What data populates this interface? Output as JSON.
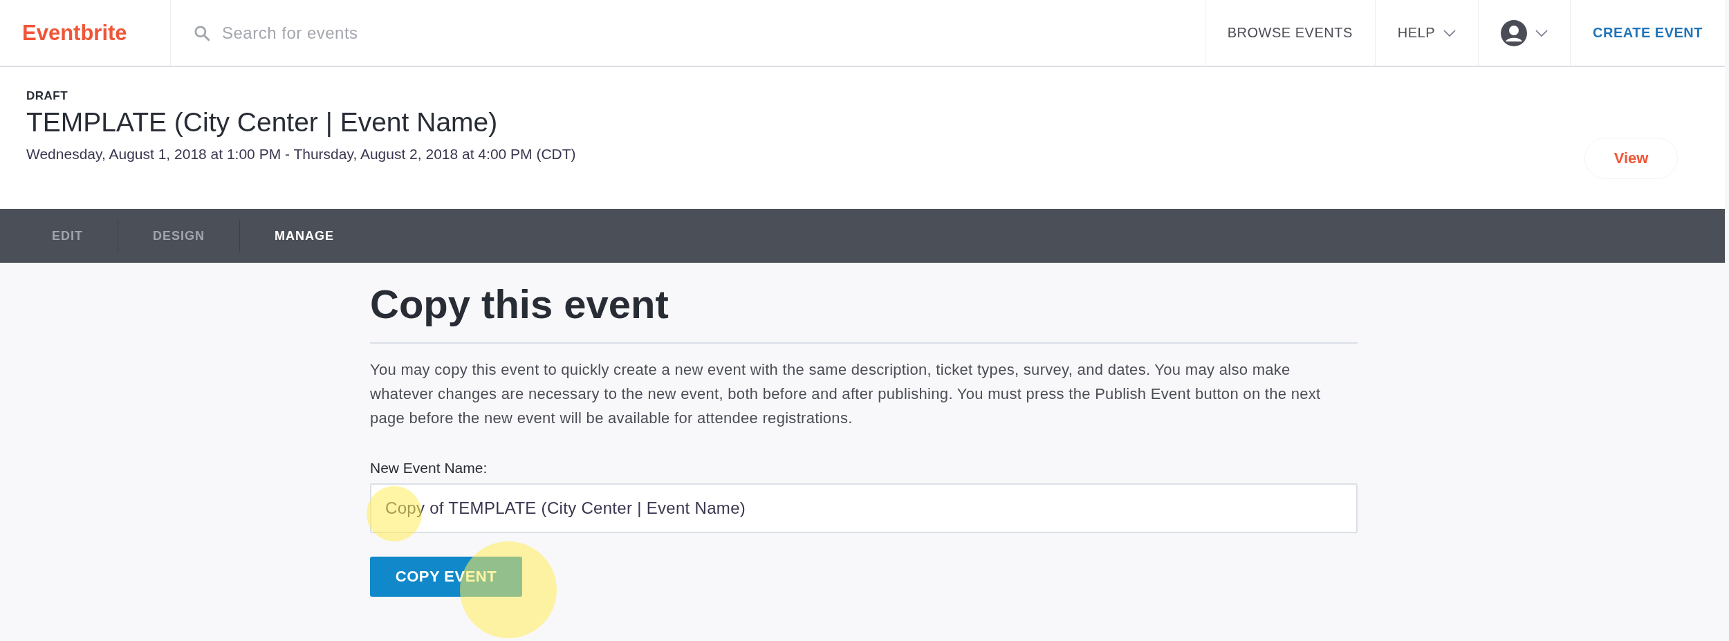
{
  "topbar": {
    "logo": "Eventbrite",
    "search": {
      "placeholder": "Search for events"
    },
    "nav": [
      {
        "label": "BROWSE EVENTS",
        "kind": "link"
      },
      {
        "label": "HELP",
        "kind": "dropdown"
      },
      {
        "kind": "avatar"
      },
      {
        "label": "CREATE EVENT",
        "kind": "primary"
      }
    ]
  },
  "event": {
    "status": "DRAFT",
    "title": "TEMPLATE (City Center | Event Name)",
    "dates": "Wednesday, August 1, 2018 at 1:00 PM - Thursday, August 2, 2018 at 4:00 PM (CDT)",
    "view_button": "View"
  },
  "tabs": [
    {
      "label": "EDIT",
      "selected": false
    },
    {
      "label": "DESIGN",
      "selected": false
    },
    {
      "label": "MANAGE",
      "selected": true
    }
  ],
  "content": {
    "heading": "Copy this event",
    "description": "You may copy this event to quickly create a new event with the same description, ticket types, survey, and dates. You may also make whatever changes are necessary to the new event, both before and after publishing. You must press the Publish Event button on the next page before the new event will be available for attendee registrations.",
    "field_label": "New Event Name:",
    "field_value": "Copy of TEMPLATE (City Center | Event Name)",
    "button": "COPY EVENT"
  }
}
